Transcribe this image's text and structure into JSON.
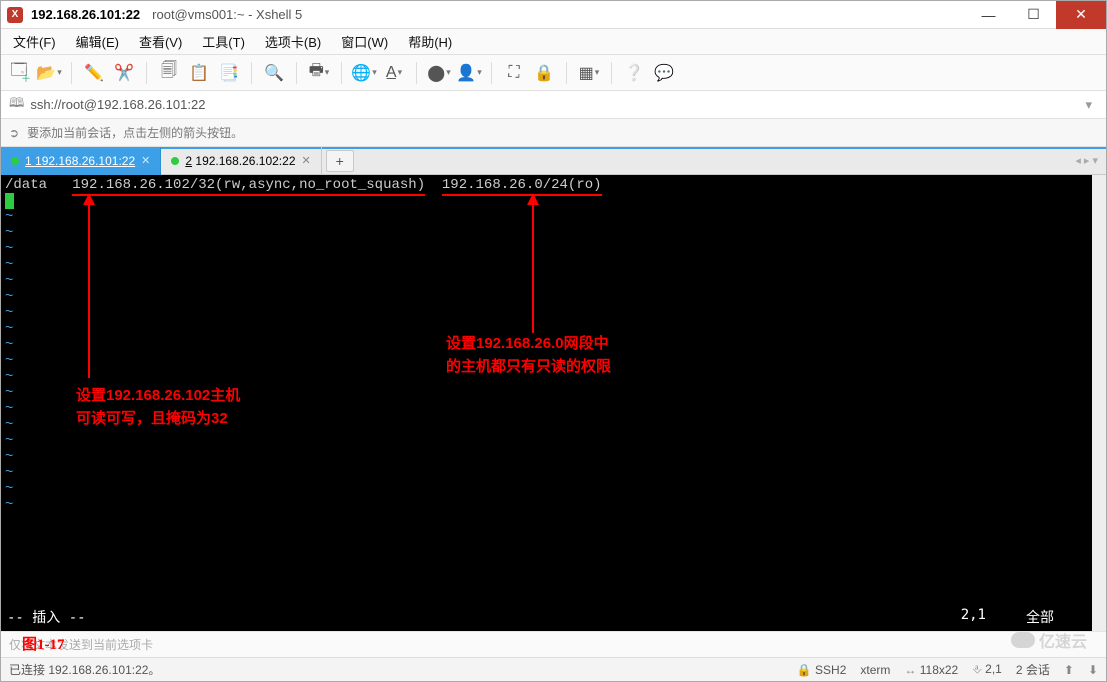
{
  "window": {
    "title_active": "192.168.26.101:22",
    "title_rest": "root@vms001:~ - Xshell 5"
  },
  "menu": {
    "file": "文件(F)",
    "edit": "编辑(E)",
    "view": "查看(V)",
    "tools": "工具(T)",
    "tabs": "选项卡(B)",
    "window": "窗口(W)",
    "help": "帮助(H)"
  },
  "address": {
    "url": "ssh://root@192.168.26.101:22"
  },
  "hint": {
    "text": "要添加当前会话，点击左侧的箭头按钮。"
  },
  "tabs": {
    "t1": {
      "num": "1",
      "label": "192.168.26.101:22"
    },
    "t2": {
      "num": "2",
      "label": "192.168.26.102:22"
    },
    "add": "+"
  },
  "terminal": {
    "line1_a": "/data",
    "line1_b": "192.168.26.102/32(rw,async,no_root_squash)",
    "line1_c": "192.168.26.0/24(ro)",
    "tilde": "~",
    "mode": "-- 插入 --",
    "pos": "2,1",
    "scroll": "全部"
  },
  "annotations": {
    "left_l1": "设置192.168.26.102主机",
    "left_l2": "可读可写，且掩码为32",
    "right_l1": "设置192.168.26.0网段中",
    "right_l2": "的主机都只有只读的权限"
  },
  "figure_label": "图1-17",
  "sendbar": {
    "text": "仅将文本发送到当前选项卡"
  },
  "status": {
    "connected": "已连接 192.168.26.101:22。",
    "ssh": "SSH2",
    "term": "xterm",
    "size": "118x22",
    "pos": "2,1",
    "sessions": "2 会话"
  },
  "watermark": "亿速云"
}
